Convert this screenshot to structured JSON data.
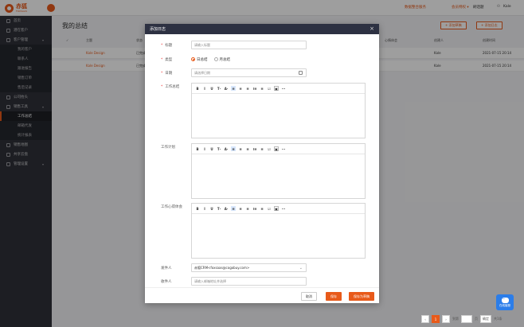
{
  "brand": {
    "name": "赤狐",
    "sub": "FOXSAAS"
  },
  "topbar": {
    "link1": "数据整合服务",
    "link2": "会员特权 ▾",
    "link3": "刷话题",
    "user": "Kale"
  },
  "sidebar": {
    "items": [
      {
        "label": "首页"
      },
      {
        "label": "潜在客户"
      },
      {
        "label": "客户管理",
        "caret": "▾"
      },
      {
        "label": "我的客户"
      },
      {
        "label": "联系人"
      },
      {
        "label": "跟进报告"
      },
      {
        "label": "销售订单"
      },
      {
        "label": "售后记录"
      },
      {
        "label": "公司抬头"
      },
      {
        "label": "销售工具",
        "caret": "▾"
      },
      {
        "label": "工作总结"
      },
      {
        "label": "邮箱代发"
      },
      {
        "label": "统计报表"
      },
      {
        "label": "销售地图"
      },
      {
        "label": "共享云盘"
      },
      {
        "label": "管理设置",
        "caret": "▾"
      }
    ]
  },
  "main": {
    "title": "我的总结",
    "btn_draft": "+ 添加草稿",
    "btn_add": "+ 添加日志",
    "columns": {
      "subject": "主题",
      "status": "状态",
      "mood": "心情体会",
      "creator": "创建人",
      "created": "创建时间"
    },
    "rows": [
      {
        "subject": "Kale Design",
        "status": "已完成",
        "creator": "Kale",
        "created": "2021-07-15 20:14"
      },
      {
        "subject": "Kale Design",
        "status": "已完成",
        "creator": "Kale",
        "created": "2021-07-15 20:14"
      }
    ]
  },
  "pager": {
    "prev": "‹",
    "current": "1",
    "next": "›",
    "goto": "到第",
    "page_unit": "页",
    "confirm": "确定",
    "total": "共1条"
  },
  "chat": {
    "label": "在线客服"
  },
  "modal": {
    "title": "添加日志",
    "close": "×",
    "fields": {
      "title_label": "标题",
      "title_placeholder": "请输入标题",
      "type_label": "类型",
      "type_daily": "日总结",
      "type_monthly": "月总结",
      "date_label": "日期",
      "date_placeholder": "请选择日期",
      "summary_label": "工作总结",
      "plan_label": "工作计划",
      "mood_label": "工作心得体会",
      "sender_label": "发件人",
      "sender_value": "赤狐CRM<foxsaas@cogobuy.com>",
      "receiver_label": "收件人",
      "receiver_placeholder": "请输入邮箱地址并选择"
    },
    "toolbar": [
      "B",
      "I",
      "U",
      "T·",
      "A·",
      "≡",
      "≡",
      "≡",
      "⁝≡",
      "≡",
      "☑",
      "▣",
      "···"
    ],
    "footer": {
      "cancel": "取消",
      "save": "保存",
      "save_draft": "保存为草稿"
    }
  },
  "colors": {
    "accent": "#e85a1a",
    "modal_header": "#2d3142",
    "sidebar": "#2f3139"
  }
}
